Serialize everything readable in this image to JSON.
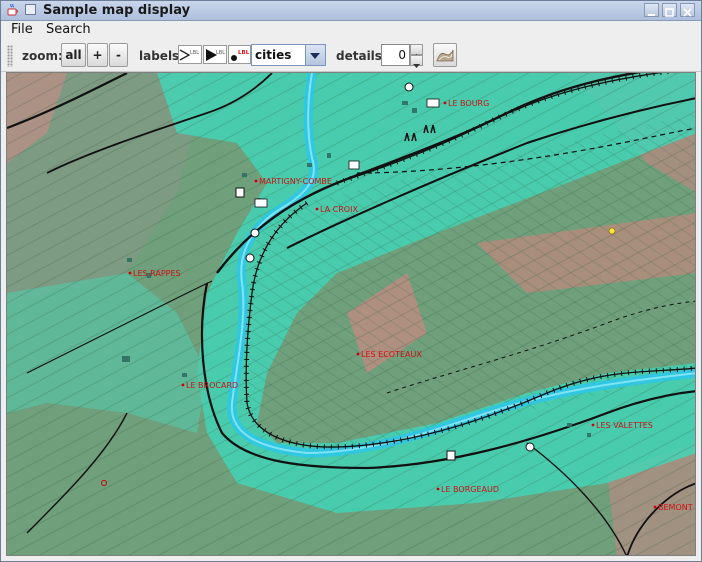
{
  "window": {
    "title": "Sample map display"
  },
  "menubar": {
    "items": [
      "File",
      "Search"
    ]
  },
  "toolbar": {
    "zoom_label": "zoom:",
    "zoom_all": "all",
    "zoom_in": "+",
    "zoom_out": "-",
    "labels_label": "labels:",
    "label_icon_text": "LBL",
    "labels_select_value": "cities",
    "details_label": "details:",
    "details_value": "0"
  },
  "map": {
    "places": [
      "LE BOURG",
      "MARTIGNY-COMBE",
      "LA CROIX",
      "LES RAPPES",
      "LES ECOTEAUX",
      "LE BROCARD",
      "LES VALETTES",
      "LE BORGEAUD",
      "BEMONT"
    ]
  },
  "colors": {
    "title_bar": "#b8c8e2",
    "map_river": "#37c7d8",
    "map_valley": "#3fd6c4",
    "map_slope": "#6aa07a",
    "place_label": "#cc1111"
  }
}
